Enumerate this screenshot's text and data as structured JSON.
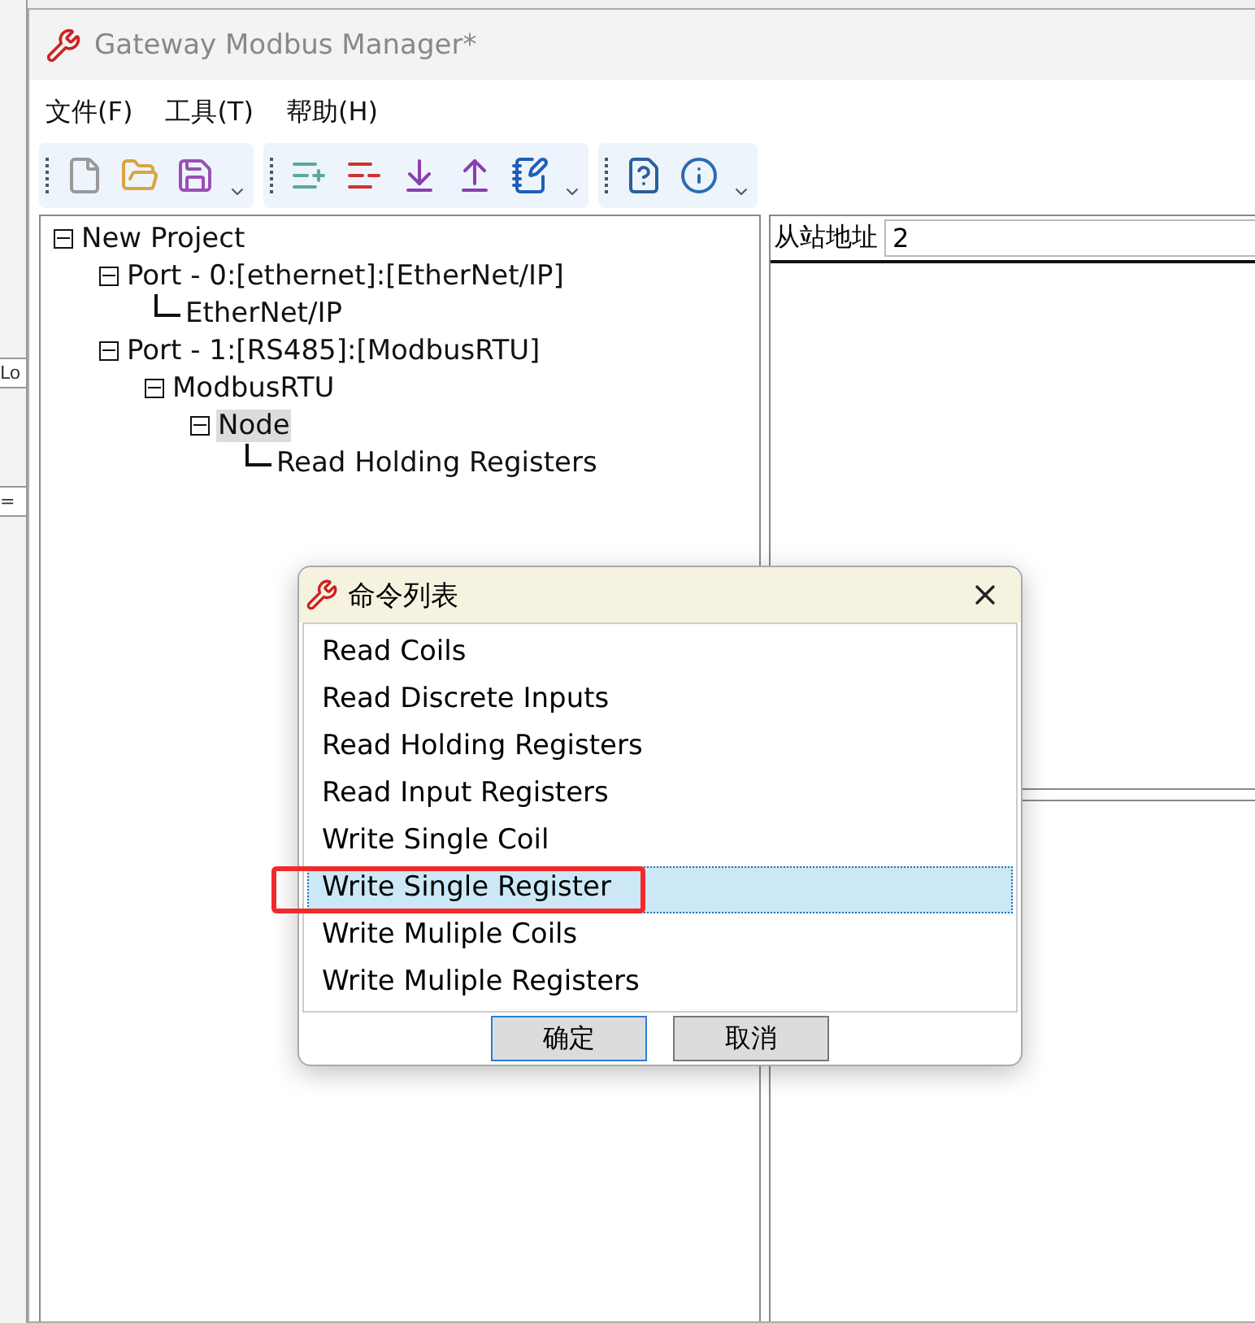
{
  "background_window": {
    "fragments": [
      "Lo",
      "="
    ]
  },
  "window": {
    "title": "Gateway Modbus Manager*"
  },
  "menu": [
    "文件(F)",
    "工具(T)",
    "帮助(H)"
  ],
  "toolbar": {
    "groups": [
      {
        "buttons": [
          {
            "kind": "new"
          },
          {
            "kind": "open"
          },
          {
            "kind": "save"
          }
        ]
      },
      {
        "buttons": [
          {
            "kind": "add"
          },
          {
            "kind": "remove"
          },
          {
            "kind": "download"
          },
          {
            "kind": "upload"
          },
          {
            "kind": "edit"
          }
        ]
      },
      {
        "buttons": [
          {
            "kind": "help"
          },
          {
            "kind": "info"
          }
        ]
      }
    ]
  },
  "tree": {
    "items": [
      {
        "label": "New Project",
        "selected": false,
        "children": [
          {
            "label": "Port - 0:[ethernet]:[EtherNet/IP]",
            "selected": false,
            "children": [
              {
                "label": "EtherNet/IP",
                "selected": false
              }
            ]
          },
          {
            "label": "Port - 1:[RS485]:[ModbusRTU]",
            "selected": false,
            "children": [
              {
                "label": "ModbusRTU",
                "selected": false,
                "children": [
                  {
                    "label": "Node",
                    "selected": true,
                    "children": [
                      {
                        "label": "Read Holding Registers",
                        "selected": false
                      }
                    ]
                  }
                ]
              }
            ]
          }
        ]
      }
    ]
  },
  "properties": {
    "label": "从站地址",
    "value": "2"
  },
  "dialog": {
    "title": "命令列表",
    "items": [
      {
        "label": "Read Coils",
        "selected": false
      },
      {
        "label": "Read Discrete Inputs",
        "selected": false
      },
      {
        "label": "Read Holding Registers",
        "selected": false
      },
      {
        "label": "Read Input Registers",
        "selected": false
      },
      {
        "label": "Write Single Coil",
        "selected": false
      },
      {
        "label": "Write Single Register",
        "selected": true
      },
      {
        "label": "Write Muliple Coils",
        "selected": false
      },
      {
        "label": "Write Muliple Registers",
        "selected": false
      }
    ],
    "buttons": [
      {
        "label": "确定",
        "default": true
      },
      {
        "label": "取消",
        "default": false
      }
    ]
  }
}
